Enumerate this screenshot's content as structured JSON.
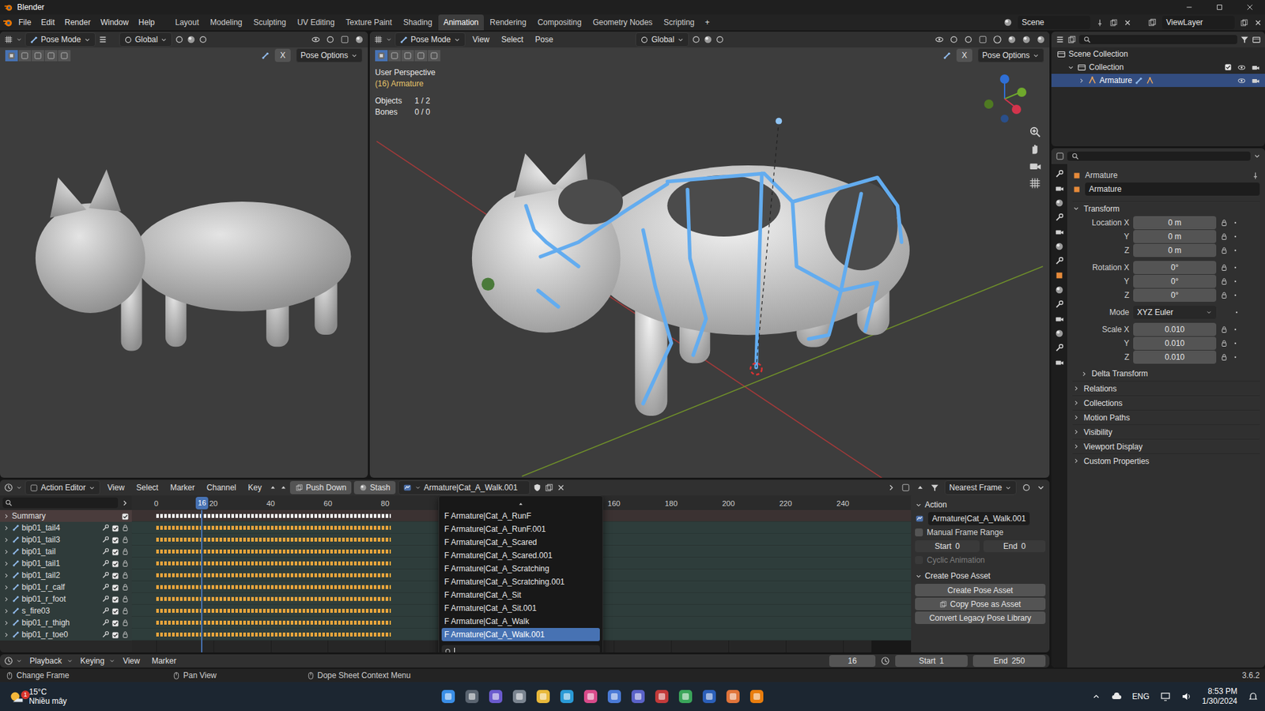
{
  "window": {
    "title": "Blender"
  },
  "menus": [
    "File",
    "Edit",
    "Render",
    "Window",
    "Help"
  ],
  "workspaces": [
    {
      "label": "Layout",
      "selected": false
    },
    {
      "label": "Modeling",
      "selected": false
    },
    {
      "label": "Sculpting",
      "selected": false
    },
    {
      "label": "UV Editing",
      "selected": false
    },
    {
      "label": "Texture Paint",
      "selected": false
    },
    {
      "label": "Shading",
      "selected": false
    },
    {
      "label": "Animation",
      "selected": true
    },
    {
      "label": "Rendering",
      "selected": false
    },
    {
      "label": "Compositing",
      "selected": false
    },
    {
      "label": "Geometry Nodes",
      "selected": false
    },
    {
      "label": "Scripting",
      "selected": false
    }
  ],
  "add_workspace": "+",
  "scene": "Scene",
  "view_layer": "ViewLayer",
  "left_viewport": {
    "mode": "Pose Mode",
    "orientation": "Global",
    "mirror_axis": "X",
    "pose_options": "Pose Options"
  },
  "right_viewport": {
    "mode": "Pose Mode",
    "menus": [
      "View",
      "Select",
      "Pose"
    ],
    "orientation": "Global",
    "mirror_axis": "X",
    "pose_options": "Pose Options",
    "overlay": {
      "perspective": "User Perspective",
      "object": "(16) Armature",
      "stats": [
        {
          "label": "Objects",
          "value": "1 / 2"
        },
        {
          "label": "Bones",
          "value": "0 / 0"
        }
      ]
    }
  },
  "outliner": {
    "items": [
      {
        "label": "Scene Collection",
        "selected": false
      },
      {
        "label": "Collection",
        "selected": false
      },
      {
        "label": "Armature",
        "selected": true
      }
    ]
  },
  "properties": {
    "object_name": "Armature",
    "data_name": "Armature",
    "transform": {
      "title": "Transform",
      "rows": [
        {
          "label": "Location X",
          "value": "0 m",
          "kind": "number"
        },
        {
          "label": "Y",
          "value": "0 m",
          "kind": "number"
        },
        {
          "label": "Z",
          "value": "0 m",
          "kind": "number"
        },
        {
          "label": "Rotation X",
          "value": "0°",
          "kind": "number"
        },
        {
          "label": "Y",
          "value": "0°",
          "kind": "number"
        },
        {
          "label": "Z",
          "value": "0°",
          "kind": "number"
        },
        {
          "label": "Mode",
          "value": "XYZ Euler",
          "kind": "dropdown"
        },
        {
          "label": "Scale X",
          "value": "0.010",
          "kind": "number"
        },
        {
          "label": "Y",
          "value": "0.010",
          "kind": "number"
        },
        {
          "label": "Z",
          "value": "0.010",
          "kind": "number"
        }
      ],
      "subsections": [
        "Delta Transform"
      ]
    },
    "sections": [
      "Relations",
      "Collections",
      "Motion Paths",
      "Visibility",
      "Viewport Display",
      "Custom Properties"
    ]
  },
  "action_editor": {
    "mode": "Action Editor",
    "menus": [
      "View",
      "Select",
      "Marker",
      "Channel",
      "Key"
    ],
    "push_down": "Push Down",
    "stash": "Stash",
    "action": "Armature|Cat_A_Walk.001",
    "snap": "Nearest Frame",
    "ruler": {
      "ticks": [
        "0",
        "20",
        "40",
        "60",
        "80",
        "160",
        "180",
        "200",
        "220",
        "240"
      ],
      "current_frame": "16"
    },
    "channels": [
      {
        "label": "Summary",
        "kind": "summary",
        "checked": true
      },
      {
        "label": "bip01_tail4",
        "kind": "group",
        "checked": true
      },
      {
        "label": "bip01_tail3",
        "kind": "group",
        "checked": true
      },
      {
        "label": "bip01_tail",
        "kind": "group",
        "checked": true
      },
      {
        "label": "bip01_tail1",
        "kind": "group",
        "checked": true
      },
      {
        "label": "bip01_tail2",
        "kind": "group",
        "checked": true
      },
      {
        "label": "bip01_r_calf",
        "kind": "group",
        "checked": true
      },
      {
        "label": "bip01_r_foot",
        "kind": "group",
        "checked": true
      },
      {
        "label": "s_fire03",
        "kind": "group",
        "checked": true
      },
      {
        "label": "bip01_r_thigh",
        "kind": "group",
        "checked": true
      },
      {
        "label": "bip01_r_toe0",
        "kind": "group",
        "checked": true
      }
    ],
    "dropdown": {
      "items": [
        {
          "label": "F Armature|Cat_A_RunF",
          "selected": false
        },
        {
          "label": "F Armature|Cat_A_RunF.001",
          "selected": false
        },
        {
          "label": "F Armature|Cat_A_Scared",
          "selected": false
        },
        {
          "label": "F Armature|Cat_A_Scared.001",
          "selected": false
        },
        {
          "label": "F Armature|Cat_A_Scratching",
          "selected": false
        },
        {
          "label": "F Armature|Cat_A_Scratching.001",
          "selected": false
        },
        {
          "label": "F Armature|Cat_A_Sit",
          "selected": false
        },
        {
          "label": "F Armature|Cat_A_Sit.001",
          "selected": false
        },
        {
          "label": "F Armature|Cat_A_Walk",
          "selected": false
        },
        {
          "label": "F Armature|Cat_A_Walk.001",
          "selected": true
        }
      ]
    }
  },
  "sidebar": {
    "action_panel": {
      "title": "Action",
      "action": "Armature|Cat_A_Walk.001",
      "manual_frame_range": {
        "label": "Manual Frame Range",
        "checked": false
      },
      "frame_range": {
        "disabled": true,
        "start_label": "Start",
        "start": "0",
        "end_label": "End",
        "end": "0"
      },
      "cyclic": {
        "label": "Cyclic Animation",
        "checked": false,
        "disabled": true
      }
    },
    "pose_panel": {
      "title": "Create Pose Asset",
      "buttons": [
        "Create Pose Asset",
        "Copy Pose as Asset",
        "Convert Legacy Pose Library"
      ]
    }
  },
  "timeline": {
    "menus": [
      "Playback",
      "Keying",
      "View",
      "Marker"
    ],
    "frame": "16",
    "start_label": "Start",
    "start": "1",
    "end_label": "End",
    "end": "250"
  },
  "status_bar": {
    "hints": [
      "Change Frame",
      "Pan View",
      "Dope Sheet Context Menu"
    ],
    "version": "3.6.2"
  },
  "taskbar": {
    "weather": {
      "temp": "15°C",
      "desc": "Nhiều mây",
      "badge": "1"
    },
    "language": "ENG",
    "time": "8:53 PM",
    "date": "1/30/2024"
  }
}
